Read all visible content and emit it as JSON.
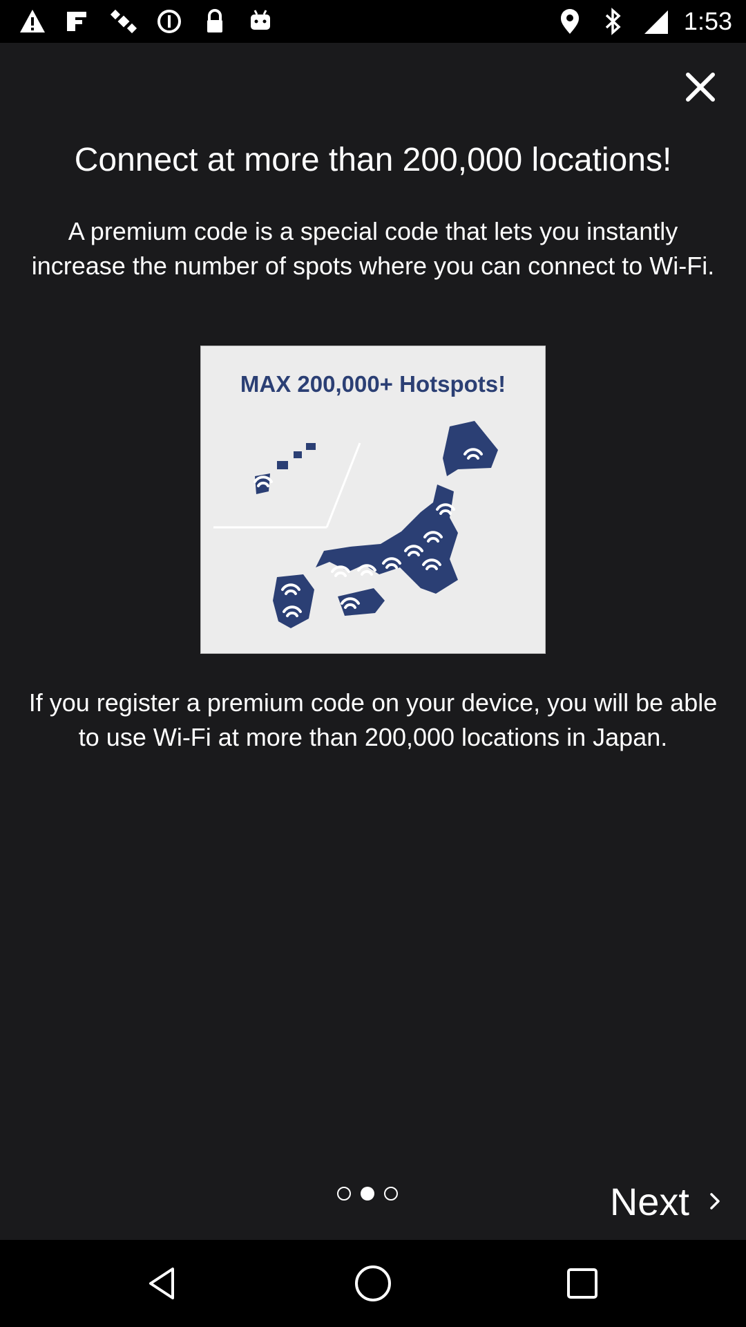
{
  "status_bar": {
    "time": "1:53",
    "left_icons": [
      "warning-icon",
      "fake-gps-icon",
      "satellite-icon",
      "data-saver-icon",
      "lock-icon",
      "android-icon"
    ],
    "right_icons": [
      "location-icon",
      "bluetooth-icon",
      "signal-icon"
    ]
  },
  "dialog": {
    "title": "Connect at more than 200,000 locations!",
    "description": "A premium code is a special code that lets you instantly increase the number of spots where you can connect to Wi-Fi.",
    "promo_image": {
      "caption": "MAX 200,000+ Hotspots!",
      "icon": "japan-wifi-map-icon",
      "accent_color": "#2b3f74"
    },
    "note": "If you register a premium code on your device, you will be able to use Wi-Fi at more than 200,000 locations in Japan.",
    "pager": {
      "total": 3,
      "current": 2
    },
    "next_label": "Next"
  },
  "nav_bar": {
    "buttons": [
      "back-icon",
      "home-icon",
      "recents-icon"
    ]
  },
  "colors": {
    "background": "#1a1a1c",
    "text": "#ffffff",
    "promo_background": "#ececec"
  }
}
